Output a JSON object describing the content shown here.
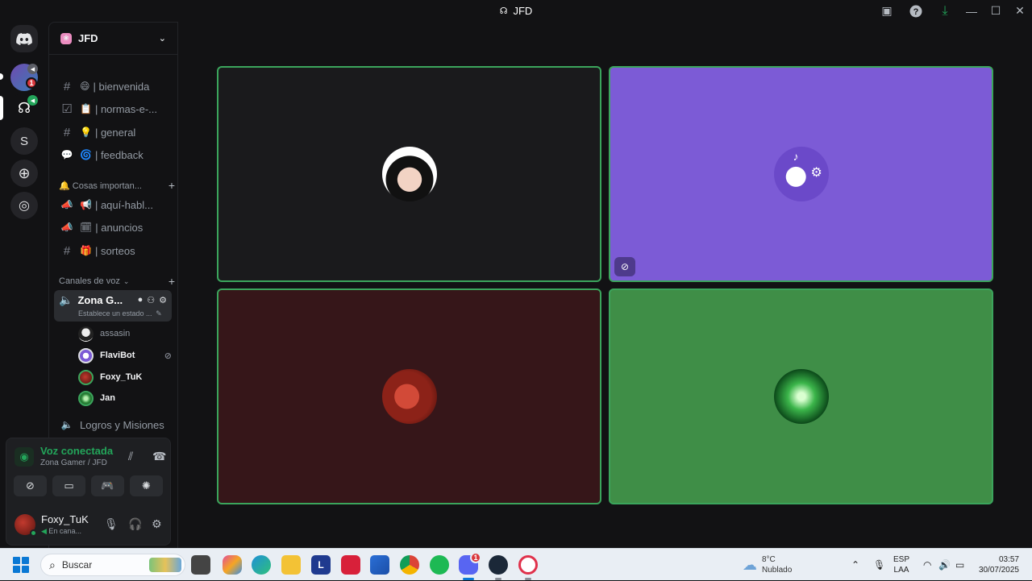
{
  "window": {
    "title": "JFD",
    "title_icon": "discord-server-icon"
  },
  "server": {
    "name": "JFD",
    "rail_letter": "S",
    "rail_badge": "1"
  },
  "channels": [
    {
      "icon": "#",
      "emoji": "😄",
      "label": "| bienvenida"
    },
    {
      "icon": "☑",
      "emoji": "📋",
      "label": "| normas-e-..."
    },
    {
      "icon": "#",
      "emoji": "💡",
      "label": "| general"
    },
    {
      "icon": "💬",
      "emoji": "🌀",
      "label": "| feedback"
    }
  ],
  "category_important": {
    "label": "🔔 Cosas importan...",
    "channels": [
      {
        "icon": "📢",
        "emoji": "📢",
        "label": "| aquí-habl..."
      },
      {
        "icon": "📢",
        "emoji": "🗓",
        "label": "| anuncios"
      },
      {
        "icon": "#",
        "emoji": "🎁",
        "label": "| sorteos"
      }
    ]
  },
  "category_voice": {
    "label": "Canales de voz",
    "active_channel": {
      "name": "Zona G...",
      "status": "Establece un estado ..."
    },
    "users": [
      {
        "name": "assasin",
        "me": false,
        "extra": ""
      },
      {
        "name": "FlaviBot",
        "me": true,
        "extra": "⊘"
      },
      {
        "name": "Foxy_TuK",
        "me": true,
        "extra": ""
      },
      {
        "name": "Jan",
        "me": true,
        "extra": ""
      }
    ],
    "next_channel": "Logros y Misiones"
  },
  "voice_panel": {
    "status": "Voz conectada",
    "location": "Zona Gamer / JFD",
    "user_name": "Foxy_TuK",
    "user_status": "En cana..."
  },
  "tiles": [
    {
      "user": "assasin",
      "bg": "#1a1a1c"
    },
    {
      "user": "FlaviBot",
      "bg": "#7c5bd6"
    },
    {
      "user": "Foxy_TuK",
      "bg": "#361619"
    },
    {
      "user": "Jan",
      "bg": "#3f8e47"
    }
  ],
  "taskbar": {
    "search_placeholder": "Buscar",
    "weather_temp": "8°C",
    "weather_desc": "Nublado",
    "lang_top": "ESP",
    "lang_bottom": "LAA",
    "time": "03:57",
    "date": "30/07/2025",
    "discord_badge": "1",
    "apps": [
      "task-view",
      "copilot",
      "edge",
      "file-explorer",
      "L",
      "opera-gx",
      "store",
      "chrome",
      "spotify",
      "discord",
      "steam",
      "opera"
    ]
  },
  "colors": {
    "accent_green": "#23a55a",
    "tile_border": "#3ba55c",
    "brand_blurple": "#5865f2"
  }
}
